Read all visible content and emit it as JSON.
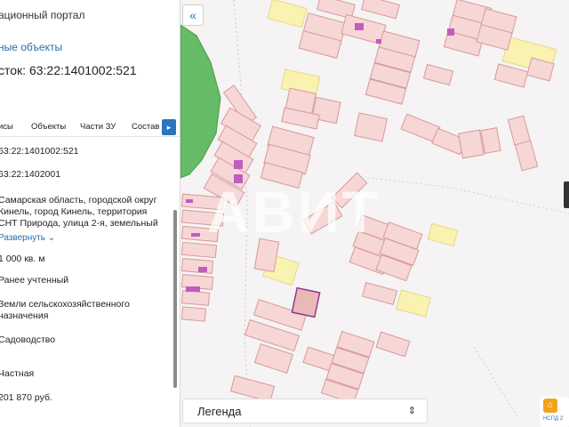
{
  "panel": {
    "portal_title": "ационный портал",
    "objects_link": "ные объекты",
    "parcel_heading": "сток: 63:22:1401002:521",
    "tabs": [
      "исы",
      "Объекты",
      "Части ЗУ",
      "Состав"
    ],
    "next_tab_icon": "chevron-right-icon",
    "cadastral_number": "63:22:1401002:521",
    "quarter": "63:22:1402001",
    "address_lines": [
      "Самарская область, городской округ",
      "Кинель, город Кинель, территория",
      "СНТ Природа, улица 2-я, земельный"
    ],
    "expand_label": "Развернуть",
    "area": "1 000 кв. м",
    "status": "Ранее учтенный",
    "category_lines": [
      "Земли сельскохозяйственного",
      "назначения"
    ],
    "permitted_use": "Садоводство",
    "ownership": "Частная",
    "cadastral_value": "201 870 руб."
  },
  "map": {
    "collapse_icon": "double-chevron-left-icon",
    "legend_label": "Легенда",
    "legend_icon": "sort-arrows-icon",
    "watermark": "АВИТ",
    "badge_text": "НСПД 2",
    "badge_icon": "home-icon",
    "colors": {
      "parcel_fill": "#f7d6d6",
      "parcel_stroke": "#d69a9a",
      "yellow_fill": "#f9f2b0",
      "green_fill": "#66bb66",
      "selected_stroke": "#8e3b8e",
      "building_fill": "#c15cc1"
    }
  }
}
